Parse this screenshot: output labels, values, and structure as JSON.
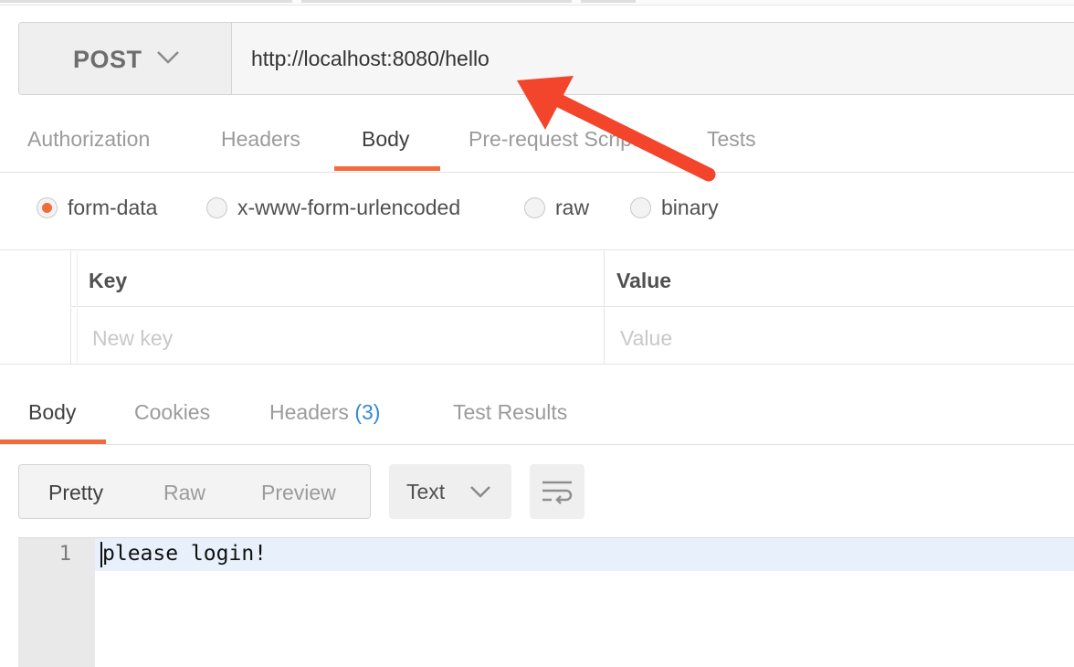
{
  "request": {
    "method": "POST",
    "url": "http://localhost:8080/hello"
  },
  "request_tabs": [
    {
      "label": "Authorization",
      "active": false
    },
    {
      "label": "Headers",
      "active": false
    },
    {
      "label": "Body",
      "active": true
    },
    {
      "label": "Pre-request Script",
      "active": false
    },
    {
      "label": "Tests",
      "active": false
    }
  ],
  "body_types": [
    {
      "label": "form-data",
      "checked": true
    },
    {
      "label": "x-www-form-urlencoded",
      "checked": false
    },
    {
      "label": "raw",
      "checked": false
    },
    {
      "label": "binary",
      "checked": false
    }
  ],
  "kv_table": {
    "key_header": "Key",
    "value_header": "Value",
    "key_placeholder": "New key",
    "value_placeholder": "Value"
  },
  "response_tabs": [
    {
      "label": "Body",
      "active": true
    },
    {
      "label": "Cookies",
      "active": false
    },
    {
      "label": "Headers",
      "count": "(3)",
      "active": false
    },
    {
      "label": "Test Results",
      "active": false
    }
  ],
  "view_modes": [
    {
      "label": "Pretty",
      "active": true
    },
    {
      "label": "Raw",
      "active": false
    },
    {
      "label": "Preview",
      "active": false
    }
  ],
  "format": "Text",
  "response_body": {
    "line_number": "1",
    "text": "please login!"
  },
  "colors": {
    "accent": "#f26b3a",
    "annotation_arrow": "#f2452c",
    "count": "#2f8ad8"
  },
  "icons": {
    "method_dropdown": "chevron-down-icon",
    "format_dropdown": "chevron-down-icon",
    "wrap": "wrap-lines-icon",
    "annotation": "annotation-arrow"
  }
}
